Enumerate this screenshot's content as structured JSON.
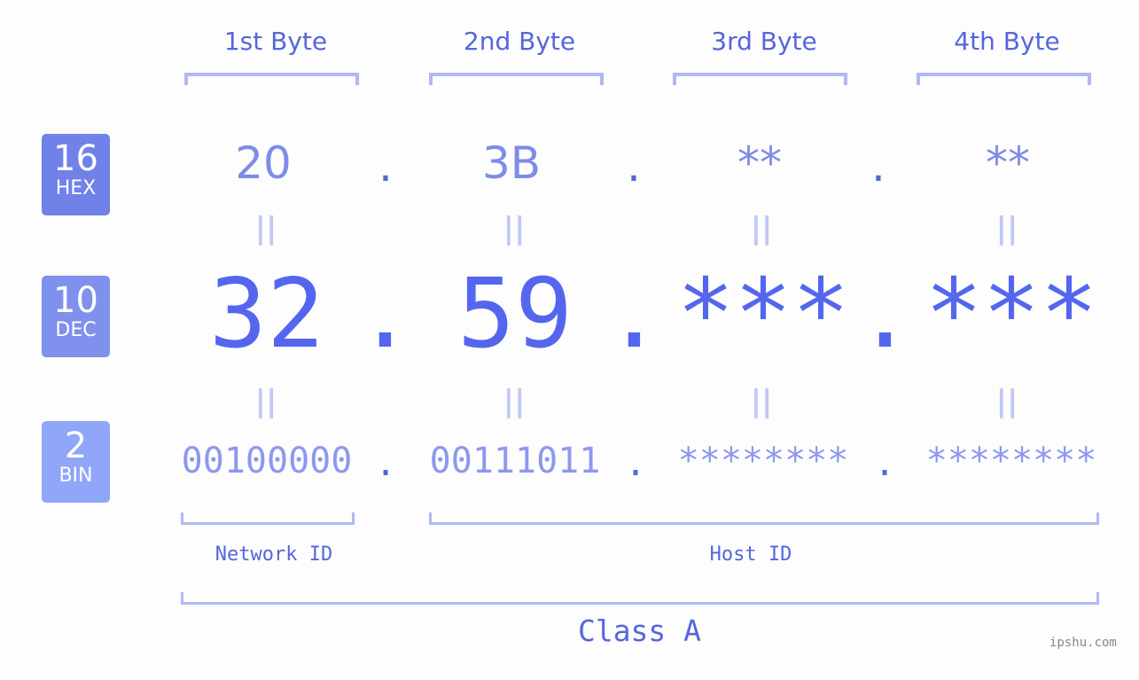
{
  "badges": [
    {
      "num": "16",
      "label": "HEX",
      "color": "#7081e8"
    },
    {
      "num": "10",
      "label": "DEC",
      "color": "#8090ed"
    },
    {
      "num": "2",
      "label": "BIN",
      "color": "#90a6f8"
    }
  ],
  "byte_headers": [
    "1st Byte",
    "2nd Byte",
    "3rd Byte",
    "4th Byte"
  ],
  "hex": [
    "20",
    "3B",
    "**",
    "**"
  ],
  "dec": [
    "32",
    "59",
    "***",
    "***"
  ],
  "bin": [
    "00100000",
    "00111011",
    "********",
    "********"
  ],
  "separator": ".",
  "equals": "||",
  "network_id_label": "Network ID",
  "host_id_label": "Host ID",
  "class_label": "Class A",
  "watermark": "ipshu.com"
}
